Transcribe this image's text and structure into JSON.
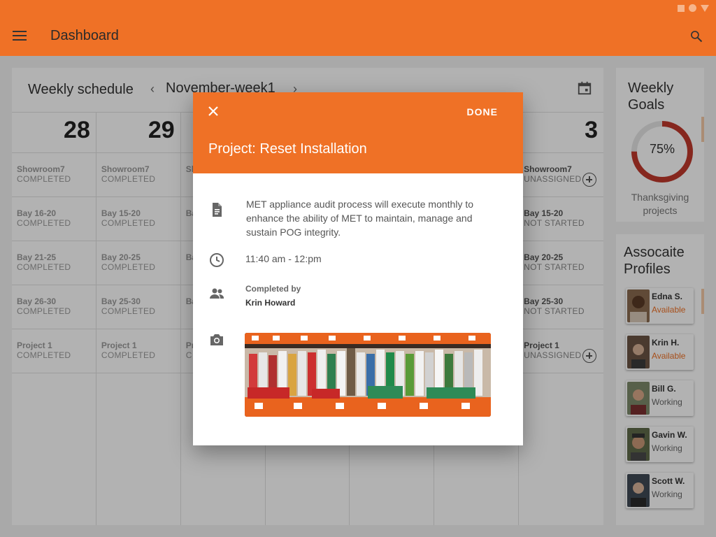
{
  "app": {
    "title": "Dashboard",
    "icons": {
      "menu": "menu-icon",
      "search": "search-icon"
    },
    "colors": {
      "accent": "#ef7126",
      "ring": "#c0392b"
    }
  },
  "schedule": {
    "title": "Weekly schedule",
    "week_label": "November-week1",
    "prev_glyph": "‹",
    "next_glyph": "›",
    "days": [
      {
        "num": "28",
        "tasks": [
          {
            "name": "Showroom7",
            "status": "COMPLETED"
          },
          {
            "name": "Bay 16-20",
            "status": "COMPLETED"
          },
          {
            "name": "Bay 21-25",
            "status": "COMPLETED"
          },
          {
            "name": "Bay 26-30",
            "status": "COMPLETED"
          },
          {
            "name": "Project 1",
            "status": "COMPLETED"
          }
        ]
      },
      {
        "num": "29",
        "tasks": [
          {
            "name": "Showroom7",
            "status": "COMPLETED"
          },
          {
            "name": "Bay 15-20",
            "status": "COMPLETED"
          },
          {
            "name": "Bay 20-25",
            "status": "COMPLETED"
          },
          {
            "name": "Bay 25-30",
            "status": "COMPLETED"
          },
          {
            "name": "Project 1",
            "status": "COMPLETED"
          }
        ]
      },
      {
        "num": "",
        "tasks": [
          {
            "name": "Sh",
            "status": ""
          },
          {
            "name": "Ba",
            "status": ""
          },
          {
            "name": "Ba",
            "status": ""
          },
          {
            "name": "Ba",
            "status": ""
          },
          {
            "name": "Pr",
            "status": "C"
          }
        ]
      },
      {
        "num": "3",
        "tasks": [
          {
            "name": "Showroom7",
            "status": "UNASSIGNED"
          },
          {
            "name": "Bay 15-20",
            "status": "NOT STARTED"
          },
          {
            "name": "Bay 20-25",
            "status": "NOT STARTED"
          },
          {
            "name": "Bay 25-30",
            "status": "NOT STARTED"
          },
          {
            "name": "Project 1",
            "status": "UNASSIGNED"
          }
        ]
      }
    ]
  },
  "goals": {
    "title": "Weekly Goals",
    "percent_label": "75%",
    "percent": 0.75,
    "subtitle": "Thanksgiving projects"
  },
  "profiles": {
    "title": "Assocaite Profiles",
    "items": [
      {
        "name": "Edna S.",
        "status": "Available"
      },
      {
        "name": "Krin H.",
        "status": "Available"
      },
      {
        "name": "Bill G.",
        "status": "Working"
      },
      {
        "name": "Gavin W.",
        "status": "Working"
      },
      {
        "name": "Scott W.",
        "status": "Working"
      }
    ]
  },
  "dialog": {
    "done_label": "DONE",
    "title": "Project: Reset Installation",
    "description": "MET appliance audit process will execute monthly to enhance the ability of MET to maintain, manage and sustain POG integrity.",
    "time": "11:40 am - 12:pm",
    "completed_by_label": "Completed by",
    "completed_by_name": "Krin Howard",
    "icons": [
      "close-icon",
      "document-icon",
      "clock-icon",
      "people-icon",
      "camera-icon"
    ]
  }
}
